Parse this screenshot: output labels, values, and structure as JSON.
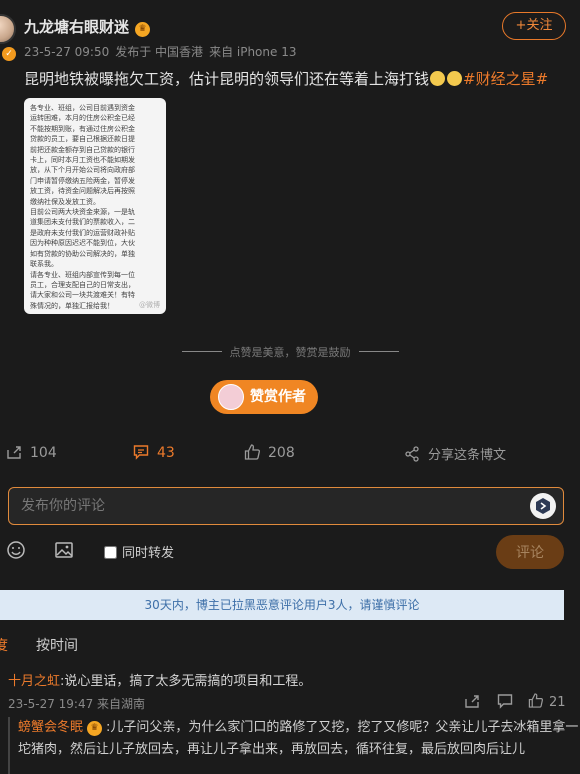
{
  "author": {
    "name": "九龙塘右眼财迷",
    "date": "23-5-27 09:50",
    "published_from": "发布于 中国香港",
    "device": "来自 iPhone 13",
    "follow_label": "+关注"
  },
  "post": {
    "text": "昆明地铁被曝拖欠工资，估计昆明的领导们还在等着上海打钱",
    "hashtag": "#财经之星#",
    "image_text": "各专业、班组，公司目前遇到资金\n运转困难，本月的住房公积金已经\n不能按期到账，有通过住房公积金\n贷款的员工，要自己根据还款日提\n前把还款金额存到自己贷款的银行\n卡上，同时本月工资也不能如期发\n放，从下个月开始公司将向政府部\n门申请暂停缴纳五险两金，暂停发\n放工资，待资金问题解决后再按照\n缴纳社保及发放工资。\n目前公司两大块资金来源，一是轨\n道集团未支付我们的票款收入，二\n是政府未支付我们的运营财政补贴\n因为种种原因迟迟不能到位，大伙\n如有贷款的协助公司解决的，单独\n联系我。\n请各专业、班组内部宣传到每一位\n员工，合理支配自己的日常支出，\n请大家和公司一块共渡难关！有特\n殊情况的，单独汇报给我！",
    "watermark": "@微博"
  },
  "divider_text": "点赞是美意，赞赏是鼓励",
  "reward_label": "赞赏作者",
  "actions": {
    "share_count": "104",
    "comment_count": "43",
    "like_count": "208",
    "repost_label": "分享这条博文"
  },
  "comment_box": {
    "placeholder": "发布你的评论",
    "repost_label": "同时转发",
    "submit_label": "评论"
  },
  "notice": "30天内，博主已拉黑恶意评论用户3人，请谨慎评论",
  "sort": {
    "left_fragment": "度",
    "time_label": "按时间"
  },
  "comments": [
    {
      "author": "十月之虹",
      "text": ":说心里话，搞了太多无需搞的项目和工程。",
      "meta": "23-5-27 19:47 来自湖南",
      "likes": "21",
      "reply": {
        "author": "螃蟹会冬眠",
        "text": ":儿子问父亲，为什么家门口的路修了又挖，挖了又修呢？父亲让儿子去冰箱里拿一坨猪肉，然后让儿子放回去，再让儿子拿出来，再放回去，循环往复，最后放回肉后让儿"
      }
    }
  ],
  "colors": {
    "accent": "#ec7a2b",
    "background": "#1b1b1b",
    "notice_bg": "#dde9f5",
    "notice_text": "#3d6fa8"
  },
  "icons": [
    "share-icon",
    "comment-icon",
    "like-icon",
    "repost-icon",
    "emoji-icon",
    "image-icon",
    "crown-icon"
  ]
}
